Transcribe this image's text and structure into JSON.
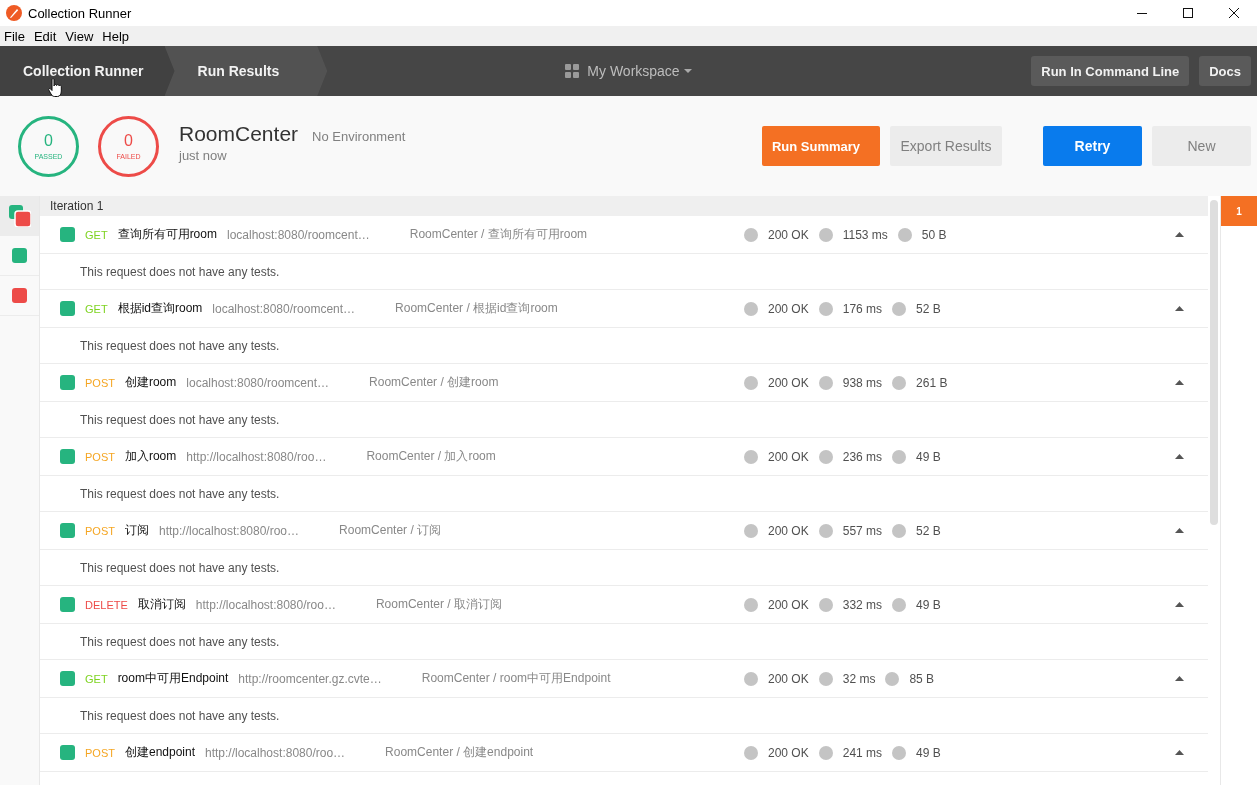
{
  "window": {
    "title": "Collection Runner"
  },
  "menu": [
    "File",
    "Edit",
    "View",
    "Help"
  ],
  "header": {
    "breadcrumbs": [
      {
        "label": "Collection Runner",
        "selected": false
      },
      {
        "label": "Run Results",
        "selected": true
      }
    ],
    "workspace": "My Workspace",
    "buttons": [
      "Run In Command Line",
      "Docs"
    ]
  },
  "summary": {
    "passed": {
      "count": "0",
      "label": "PASSED"
    },
    "failed": {
      "count": "0",
      "label": "FAILED"
    },
    "collection": "RoomCenter",
    "environment": "No Environment",
    "time": "just now",
    "actions": [
      {
        "label": "Run Summary",
        "kind": "primary"
      },
      {
        "label": "Export Results",
        "kind": "secondary"
      },
      {
        "label": "Retry",
        "kind": "accent"
      },
      {
        "label": "New",
        "kind": "secondary"
      }
    ]
  },
  "filters": [
    {
      "kind": "all",
      "selected": true
    },
    {
      "kind": "passed",
      "selected": false
    },
    {
      "kind": "failed",
      "selected": false
    }
  ],
  "iteration": {
    "title": "Iteration 1",
    "requests": [
      {
        "passed": true,
        "method": {
          "text": "GET",
          "color": "#7ed321"
        },
        "name": "查询所有可用room",
        "url": "localhost:8080/roomcent…",
        "path": "RoomCenter / 查询所有可用room",
        "status": "200 OK",
        "time": "1153 ms",
        "size": "50 B",
        "expanded": true,
        "note": "This request does not have any tests."
      },
      {
        "passed": true,
        "method": {
          "text": "GET",
          "color": "#7ed321"
        },
        "name": "根据id查询room",
        "url": "localhost:8080/roomcent…",
        "path": "RoomCenter / 根据id查询room",
        "status": "200 OK",
        "time": "176 ms",
        "size": "52 B",
        "expanded": true,
        "note": "This request does not have any tests."
      },
      {
        "passed": true,
        "method": {
          "text": "POST",
          "color": "#f5a623"
        },
        "name": "创建room",
        "url": "localhost:8080/roomcent…",
        "path": "RoomCenter / 创建room",
        "status": "200 OK",
        "time": "938 ms",
        "size": "261 B",
        "expanded": true,
        "note": "This request does not have any tests."
      },
      {
        "passed": true,
        "method": {
          "text": "POST",
          "color": "#f5a623"
        },
        "name": "加入room",
        "url": "http://localhost:8080/roo…",
        "path": "RoomCenter / 加入room",
        "status": "200 OK",
        "time": "236 ms",
        "size": "49 B",
        "expanded": true,
        "note": "This request does not have any tests."
      },
      {
        "passed": true,
        "method": {
          "text": "POST",
          "color": "#f5a623"
        },
        "name": "订阅",
        "url": "http://localhost:8080/roo…",
        "path": "RoomCenter / 订阅",
        "status": "200 OK",
        "time": "557 ms",
        "size": "52 B",
        "expanded": true,
        "note": "This request does not have any tests."
      },
      {
        "passed": true,
        "method": {
          "text": "DELETE",
          "color": "#ed4b48"
        },
        "name": "取消订阅",
        "url": "http://localhost:8080/roo…",
        "path": "RoomCenter / 取消订阅",
        "status": "200 OK",
        "time": "332 ms",
        "size": "49 B",
        "expanded": true,
        "note": "This request does not have any tests."
      },
      {
        "passed": true,
        "method": {
          "text": "GET",
          "color": "#7ed321"
        },
        "name": "room中可用Endpoint",
        "url": "http://roomcenter.gz.cvte…",
        "path": "RoomCenter / room中可用Endpoint",
        "status": "200 OK",
        "time": "32 ms",
        "size": "85 B",
        "expanded": true,
        "note": "This request does not have any tests."
      },
      {
        "passed": true,
        "method": {
          "text": "POST",
          "color": "#f5a623"
        },
        "name": "创建endpoint",
        "url": "http://localhost:8080/roo…",
        "path": "RoomCenter / 创建endpoint",
        "status": "200 OK",
        "time": "241 ms",
        "size": "49 B",
        "expanded": true
      }
    ]
  },
  "iteration_tabs": [
    {
      "label": "1",
      "selected": true
    }
  ]
}
